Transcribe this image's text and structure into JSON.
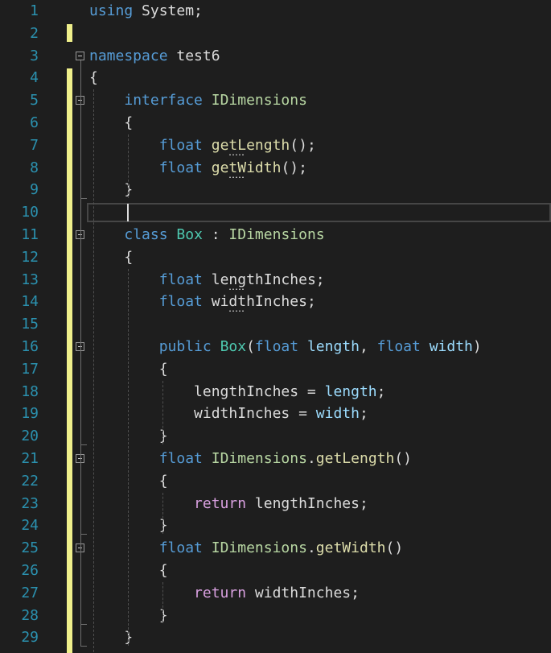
{
  "editor": {
    "lines": [
      {
        "n": "1",
        "tokens": [
          {
            "t": "using ",
            "c": "kw"
          },
          {
            "t": "System;",
            "c": "plain"
          }
        ]
      },
      {
        "n": "2",
        "tokens": []
      },
      {
        "n": "3",
        "tokens": [
          {
            "t": "namespace ",
            "c": "kw"
          },
          {
            "t": "test6",
            "c": "plain"
          }
        ]
      },
      {
        "n": "4",
        "tokens": [
          {
            "t": "{",
            "c": "plain"
          }
        ]
      },
      {
        "n": "5",
        "tokens": [
          {
            "t": "    ",
            "c": "plain"
          },
          {
            "t": "interface ",
            "c": "kw"
          },
          {
            "t": "IDimensions",
            "c": "ity"
          }
        ]
      },
      {
        "n": "6",
        "tokens": [
          {
            "t": "    {",
            "c": "plain"
          }
        ]
      },
      {
        "n": "7",
        "tokens": [
          {
            "t": "        ",
            "c": "plain"
          },
          {
            "t": "float ",
            "c": "kw"
          },
          {
            "t": "getLength",
            "c": "mth"
          },
          {
            "t": "();",
            "c": "plain"
          }
        ]
      },
      {
        "n": "8",
        "tokens": [
          {
            "t": "        ",
            "c": "plain"
          },
          {
            "t": "float ",
            "c": "kw"
          },
          {
            "t": "getWidth",
            "c": "mth"
          },
          {
            "t": "();",
            "c": "plain"
          }
        ]
      },
      {
        "n": "9",
        "tokens": [
          {
            "t": "    }",
            "c": "plain"
          }
        ]
      },
      {
        "n": "10",
        "tokens": []
      },
      {
        "n": "11",
        "tokens": [
          {
            "t": "    ",
            "c": "plain"
          },
          {
            "t": "class ",
            "c": "kw"
          },
          {
            "t": "Box",
            "c": "typ"
          },
          {
            "t": " : ",
            "c": "plain"
          },
          {
            "t": "IDimensions",
            "c": "ity"
          }
        ]
      },
      {
        "n": "12",
        "tokens": [
          {
            "t": "    {",
            "c": "plain"
          }
        ]
      },
      {
        "n": "13",
        "tokens": [
          {
            "t": "        ",
            "c": "plain"
          },
          {
            "t": "float ",
            "c": "kw"
          },
          {
            "t": "lengthInches;",
            "c": "plain"
          }
        ]
      },
      {
        "n": "14",
        "tokens": [
          {
            "t": "        ",
            "c": "plain"
          },
          {
            "t": "float ",
            "c": "kw"
          },
          {
            "t": "widthInches;",
            "c": "plain"
          }
        ]
      },
      {
        "n": "15",
        "tokens": []
      },
      {
        "n": "16",
        "tokens": [
          {
            "t": "        ",
            "c": "plain"
          },
          {
            "t": "public ",
            "c": "kw"
          },
          {
            "t": "Box",
            "c": "typ"
          },
          {
            "t": "(",
            "c": "plain"
          },
          {
            "t": "float ",
            "c": "kw"
          },
          {
            "t": "length",
            "c": "prm"
          },
          {
            "t": ", ",
            "c": "plain"
          },
          {
            "t": "float ",
            "c": "kw"
          },
          {
            "t": "width",
            "c": "prm"
          },
          {
            "t": ")",
            "c": "plain"
          }
        ]
      },
      {
        "n": "17",
        "tokens": [
          {
            "t": "        {",
            "c": "plain"
          }
        ]
      },
      {
        "n": "18",
        "tokens": [
          {
            "t": "            lengthInches = ",
            "c": "plain"
          },
          {
            "t": "length",
            "c": "prm"
          },
          {
            "t": ";",
            "c": "plain"
          }
        ]
      },
      {
        "n": "19",
        "tokens": [
          {
            "t": "            widthInches = ",
            "c": "plain"
          },
          {
            "t": "width",
            "c": "prm"
          },
          {
            "t": ";",
            "c": "plain"
          }
        ]
      },
      {
        "n": "20",
        "tokens": [
          {
            "t": "        }",
            "c": "plain"
          }
        ]
      },
      {
        "n": "21",
        "tokens": [
          {
            "t": "        ",
            "c": "plain"
          },
          {
            "t": "float ",
            "c": "kw"
          },
          {
            "t": "IDimensions",
            "c": "ity"
          },
          {
            "t": ".",
            "c": "plain"
          },
          {
            "t": "getLength",
            "c": "mth"
          },
          {
            "t": "()",
            "c": "plain"
          }
        ]
      },
      {
        "n": "22",
        "tokens": [
          {
            "t": "        {",
            "c": "plain"
          }
        ]
      },
      {
        "n": "23",
        "tokens": [
          {
            "t": "            ",
            "c": "plain"
          },
          {
            "t": "return ",
            "c": "ctl"
          },
          {
            "t": "lengthInches;",
            "c": "plain"
          }
        ]
      },
      {
        "n": "24",
        "tokens": [
          {
            "t": "        }",
            "c": "plain"
          }
        ]
      },
      {
        "n": "25",
        "tokens": [
          {
            "t": "        ",
            "c": "plain"
          },
          {
            "t": "float ",
            "c": "kw"
          },
          {
            "t": "IDimensions",
            "c": "ity"
          },
          {
            "t": ".",
            "c": "plain"
          },
          {
            "t": "getWidth",
            "c": "mth"
          },
          {
            "t": "()",
            "c": "plain"
          }
        ]
      },
      {
        "n": "26",
        "tokens": [
          {
            "t": "        {",
            "c": "plain"
          }
        ]
      },
      {
        "n": "27",
        "tokens": [
          {
            "t": "            ",
            "c": "plain"
          },
          {
            "t": "return ",
            "c": "ctl"
          },
          {
            "t": "widthInches;",
            "c": "plain"
          }
        ]
      },
      {
        "n": "28",
        "tokens": [
          {
            "t": "        }",
            "c": "plain"
          }
        ]
      },
      {
        "n": "29",
        "tokens": [
          {
            "t": "    }",
            "c": "plain"
          }
        ]
      }
    ],
    "current_line": "10",
    "colors": {
      "background": "#1e1e1e",
      "line_number": "#2b91af",
      "keyword": "#569cd6",
      "control_keyword": "#d8a0df",
      "type": "#4ec9b0",
      "interface": "#b8d7a3",
      "method": "#dcdcaa",
      "parameter": "#9cdcfe",
      "text": "#dcdcdc",
      "change_marker": "#efef8b"
    },
    "icons": [
      "fold-collapse-icon"
    ]
  }
}
